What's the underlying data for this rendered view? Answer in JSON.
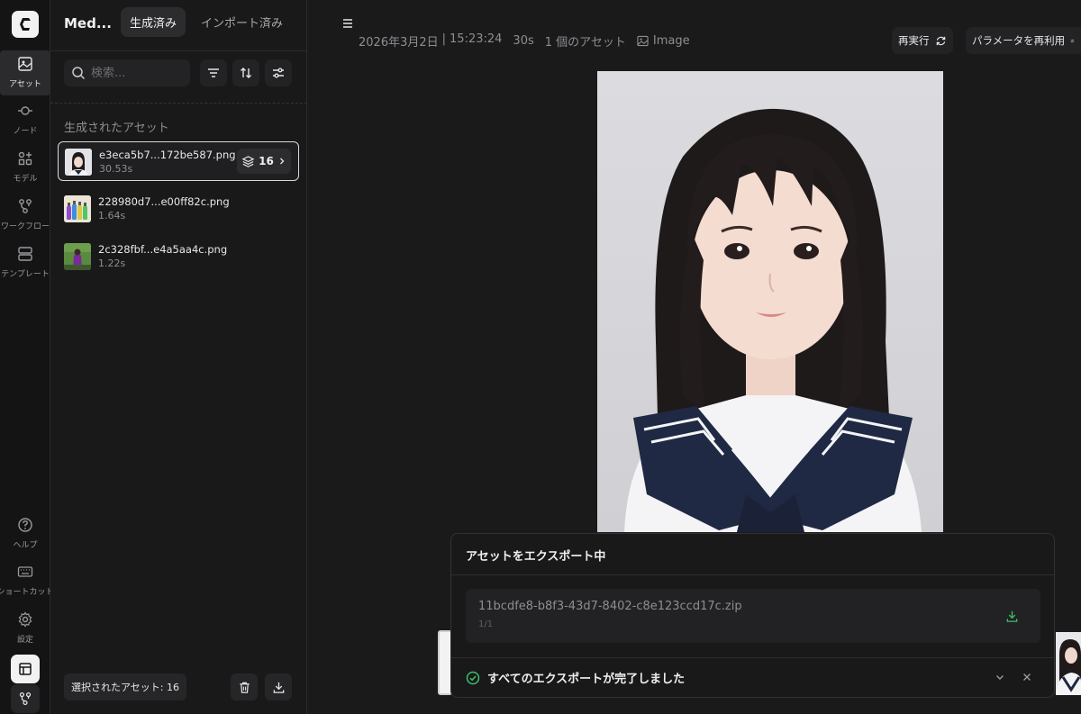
{
  "rail": {
    "items": [
      {
        "label": "アセット",
        "icon": "asset-icon"
      },
      {
        "label": "ノード",
        "icon": "node-icon"
      },
      {
        "label": "モデル",
        "icon": "model-icon"
      },
      {
        "label": "ワークフロー",
        "icon": "workflow-icon"
      },
      {
        "label": "テンプレート",
        "icon": "template-icon"
      }
    ],
    "bottom": [
      {
        "label": "ヘルプ",
        "icon": "help-icon"
      },
      {
        "label": "ショートカット",
        "icon": "keyboard-icon"
      },
      {
        "label": "設定",
        "icon": "gear-icon"
      }
    ]
  },
  "panel": {
    "title": "Med...",
    "tabs": [
      "生成済み",
      "インポート済み"
    ],
    "search_placeholder": "検索...",
    "section_label": "生成されたアセット",
    "assets": [
      {
        "name": "e3eca5b7...172be587.png",
        "time": "30.53s",
        "count": "16"
      },
      {
        "name": "228980d7...e00ff82c.png",
        "time": "1.64s"
      },
      {
        "name": "2c328fbf...e4a5aa4c.png",
        "time": "1.22s"
      }
    ],
    "selected_label": "選択されたアセット: 16"
  },
  "main": {
    "date": "2026年3月2日",
    "sep": "|",
    "clock": "15:23:24",
    "duration": "30s",
    "asset_count": "1 個のアセット",
    "type": "Image",
    "rerun_label": "再実行",
    "reuse_label": "パラメータを再利用"
  },
  "export": {
    "title": "アセットをエクスポート中",
    "file_name": "11bcdfe8-b8f3-43d7-8402-c8e123ccd17c.zip",
    "progress": "1/1",
    "done_text": "すべてのエクスポートが完了しました"
  },
  "colors": {
    "accent_green": "#3fbf6a",
    "background": "#1a1a1b"
  }
}
